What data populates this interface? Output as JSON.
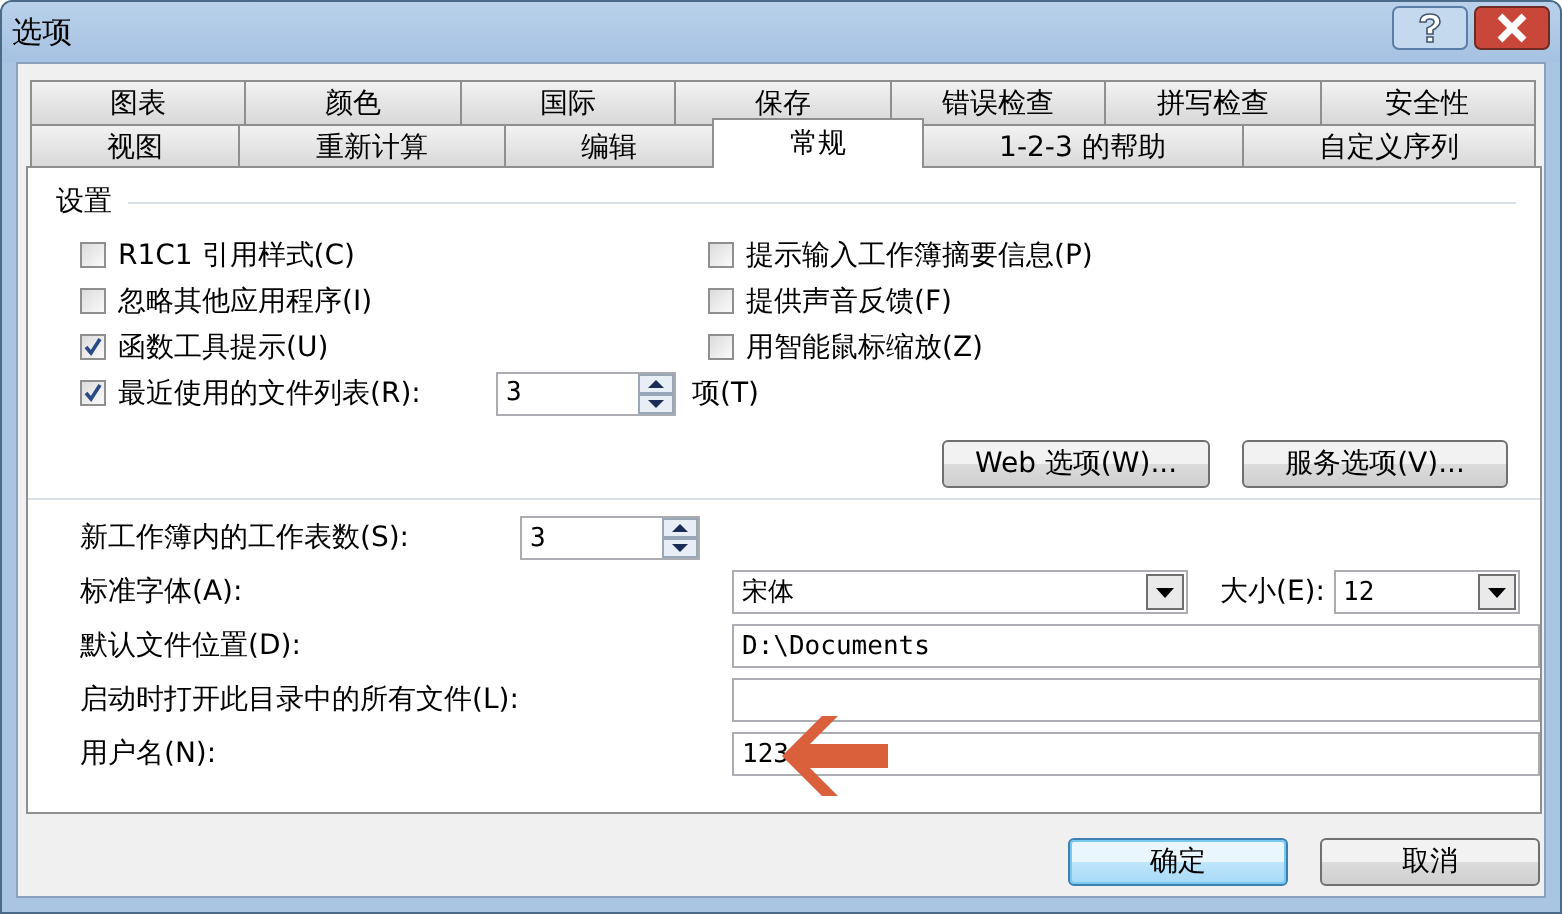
{
  "window": {
    "title": "选项"
  },
  "tabs_row1": [
    {
      "label": "图表",
      "selected": false
    },
    {
      "label": "颜色",
      "selected": false
    },
    {
      "label": "国际",
      "selected": false
    },
    {
      "label": "保存",
      "selected": false
    },
    {
      "label": "错误检查",
      "selected": false
    },
    {
      "label": "拼写检查",
      "selected": false
    },
    {
      "label": "安全性",
      "selected": false
    }
  ],
  "tabs_row2": [
    {
      "label": "视图",
      "selected": false
    },
    {
      "label": "重新计算",
      "selected": false
    },
    {
      "label": "编辑",
      "selected": false
    },
    {
      "label": "常规",
      "selected": true
    },
    {
      "label": "1-2-3 的帮助",
      "selected": false
    },
    {
      "label": "自定义序列",
      "selected": false
    }
  ],
  "settings": {
    "legend": "设置",
    "checkboxes": [
      {
        "label": "R1C1 引用样式(C)",
        "checked": false
      },
      {
        "label": "提示输入工作簿摘要信息(P)",
        "checked": false
      },
      {
        "label": "忽略其他应用程序(I)",
        "checked": false
      },
      {
        "label": "提供声音反馈(F)",
        "checked": false
      },
      {
        "label": "函数工具提示(U)",
        "checked": true
      },
      {
        "label": "用智能鼠标缩放(Z)",
        "checked": false
      }
    ],
    "recent_files": {
      "label": "最近使用的文件列表(R):",
      "checked": true,
      "value": "3",
      "unit": "项(T)"
    },
    "buttons": [
      "Web 选项(W)...",
      "服务选项(V)..."
    ]
  },
  "sheets": {
    "label": "新工作簿内的工作表数(S):",
    "value": "3"
  },
  "font": {
    "label": "标准字体(A):",
    "value": "宋体",
    "size_label": "大小(E):",
    "size_value": "12"
  },
  "location": {
    "label": "默认文件位置(D):",
    "value": "D:\\Documents"
  },
  "startup": {
    "label": "启动时打开此目录中的所有文件(L):"
  },
  "username": {
    "label": "用户名(N):",
    "value": "123"
  },
  "dialog_buttons": [
    {
      "label": "确定",
      "default": true
    },
    {
      "label": "取消",
      "default": false
    }
  ]
}
